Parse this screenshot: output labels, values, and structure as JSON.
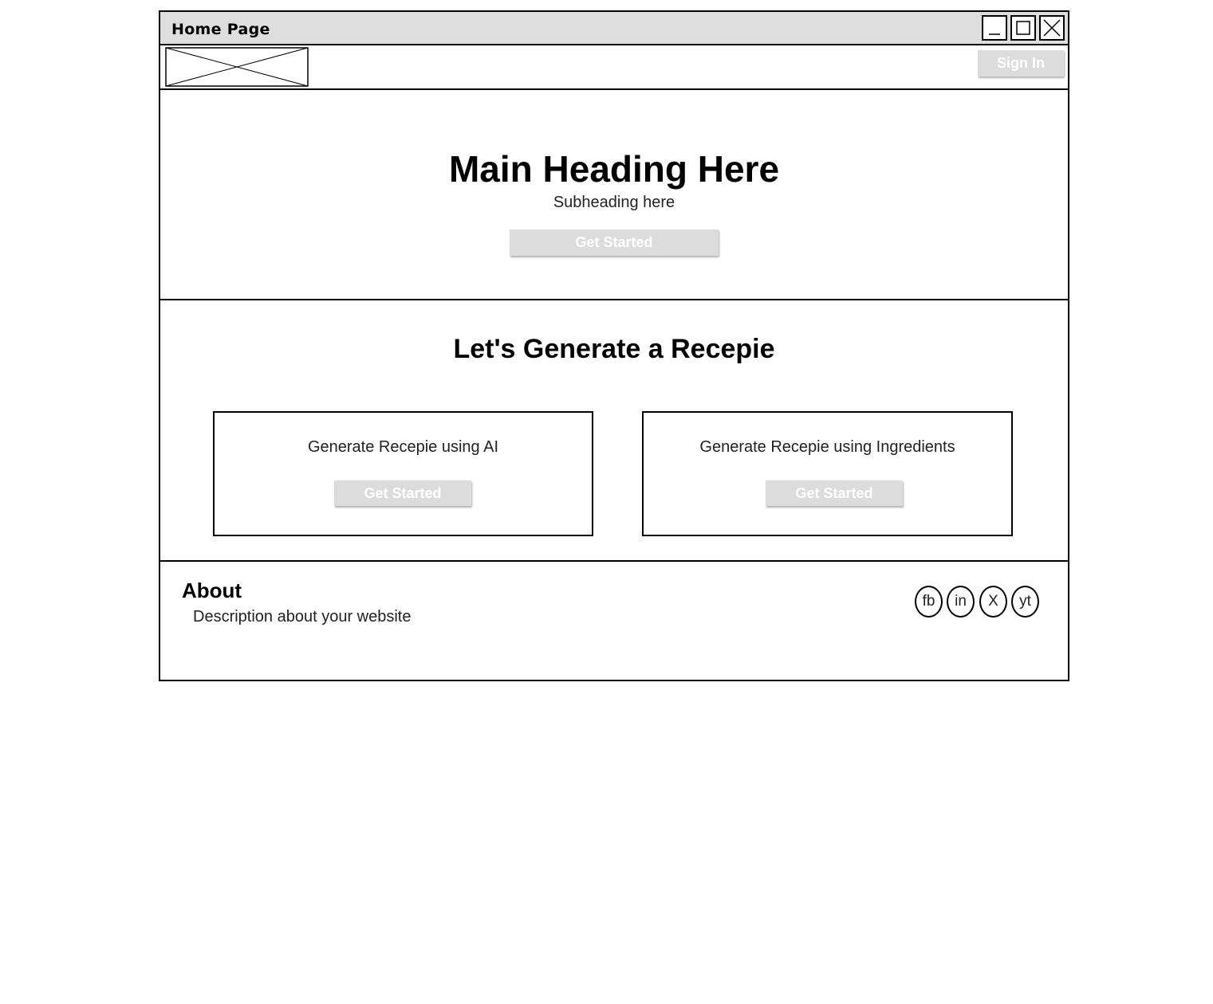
{
  "window": {
    "title": "Home Page"
  },
  "navbar": {
    "sign_in_label": "Sign In"
  },
  "hero": {
    "title": "Main Heading Here",
    "subtitle": "Subheading here",
    "button_label": "Get Started"
  },
  "generate": {
    "title": "Let's Generate a Recepie",
    "cards": [
      {
        "label": "Generate Recepie using AI",
        "button_label": "Get Started"
      },
      {
        "label": "Generate Recepie using Ingredients",
        "button_label": "Get Started"
      }
    ]
  },
  "footer": {
    "about_title": "About",
    "about_description": "Description about your website",
    "social": [
      {
        "label": "fb",
        "icon": "facebook-icon"
      },
      {
        "label": "in",
        "icon": "linkedin-icon"
      },
      {
        "label": "X",
        "icon": "x-icon"
      },
      {
        "label": "yt",
        "icon": "youtube-icon"
      }
    ]
  },
  "colors": {
    "button_fill": "#dcdcdc",
    "button_text": "#ffffff",
    "titlebar": "#dedede",
    "border": "#000000"
  }
}
